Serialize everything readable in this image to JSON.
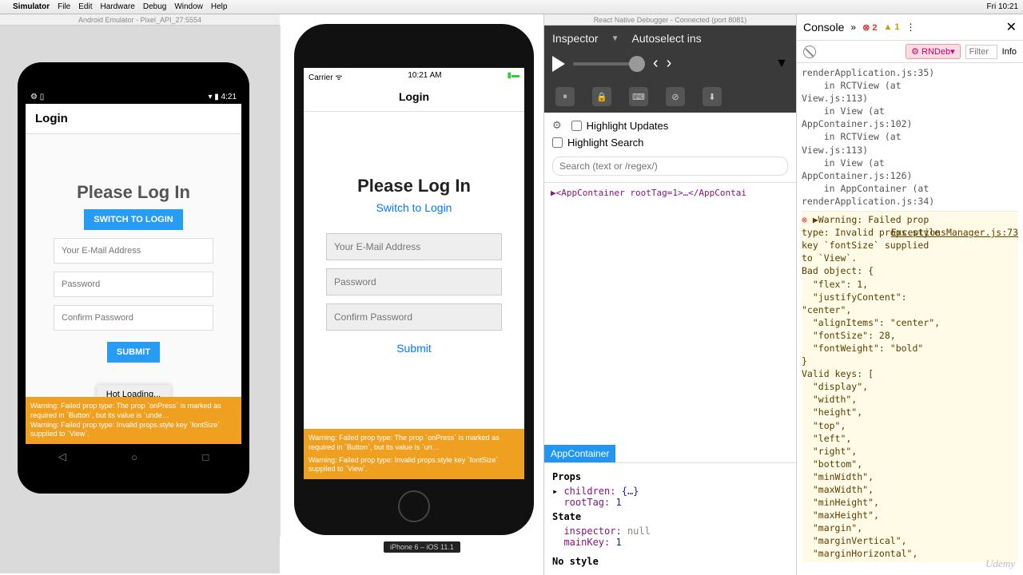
{
  "menubar": {
    "app": "Simulator",
    "items": [
      "File",
      "Edit",
      "Hardware",
      "Debug",
      "Window",
      "Help"
    ],
    "clock": "Fri 10:21"
  },
  "android_window_title": "Android Emulator - Pixel_API_27:5554",
  "android": {
    "status_time": "4:21",
    "header": "Login",
    "title": "Please Log In",
    "switch_btn": "SWITCH TO LOGIN",
    "email_ph": "Your E-Mail Address",
    "pw_ph": "Password",
    "cpw_ph": "Confirm Password",
    "submit": "SUBMIT",
    "warn1": "Warning: Failed prop type: The prop `onPress` is marked as required in `Button`, but its value is `unde…",
    "warn2": "Warning: Failed prop type: Invalid props.style key `fontSize` supplied to `View`.",
    "hot": "Hot Loading..."
  },
  "iphone": {
    "carrier": "Carrier ᯤ",
    "time": "10:21 AM",
    "header": "Login",
    "title": "Please Log In",
    "switch": "Switch to Login",
    "email_ph": "Your E-Mail Address",
    "pw_ph": "Password",
    "cpw_ph": "Confirm Password",
    "submit": "Submit",
    "warn1": "Warning: Failed prop type: The prop `onPress` is marked as required in `Button`, but its value is `un…",
    "warn2": "Warning: Failed prop type: Invalid props.style key `fontSize` supplied to `View`.",
    "device_label": "iPhone 6 – iOS 11.1"
  },
  "debugger": {
    "win_title": "React Native Debugger - Connected (port 8081)",
    "tab1": "Inspector",
    "tab2": "Autoselect ins",
    "hl_updates": "Highlight Updates",
    "hl_search": "Highlight Search",
    "search_ph": "Search (text or /regex/)",
    "tree": "▶<AppContainer rootTag=1>…</AppContai",
    "selected": "AppContainer",
    "props_label": "Props",
    "children_k": "children:",
    "children_v": "{…}",
    "roottag_k": "rootTag:",
    "roottag_v": "1",
    "state_label": "State",
    "inspector_k": "inspector:",
    "inspector_v": "null",
    "mainkey_k": "mainKey:",
    "mainkey_v": "1",
    "nostyle": "No style"
  },
  "console": {
    "title": "Console",
    "err_count": "2",
    "warn_count": "1",
    "rndeb": "⚙ RNDeb▾",
    "filter": "Filter",
    "info": "Info",
    "stack": "renderApplication.js:35)\n    in RCTView (at\nView.js:113)\n    in View (at\nAppContainer.js:102)\n    in RCTView (at\nView.js:113)\n    in View (at\nAppContainer.js:126)\n    in AppContainer (at\nrenderApplication.js:34)",
    "warn_head": "▶Warning: Failed prop",
    "warn_src": "ExceptionsManager.js:73",
    "warn_body": "type: Invalid props.style\nkey `fontSize` supplied\nto `View`.\nBad object: {\n  \"flex\": 1,\n  \"justifyContent\":\n\"center\",\n  \"alignItems\": \"center\",\n  \"fontSize\": 28,\n  \"fontWeight\": \"bold\"\n}\nValid keys: [\n  \"display\",\n  \"width\",\n  \"height\",\n  \"top\",\n  \"left\",\n  \"right\",\n  \"bottom\",\n  \"minWidth\",\n  \"maxWidth\",\n  \"minHeight\",\n  \"maxHeight\",\n  \"margin\",\n  \"marginVertical\",\n  \"marginHorizontal\","
  },
  "udemy": "Udemy"
}
